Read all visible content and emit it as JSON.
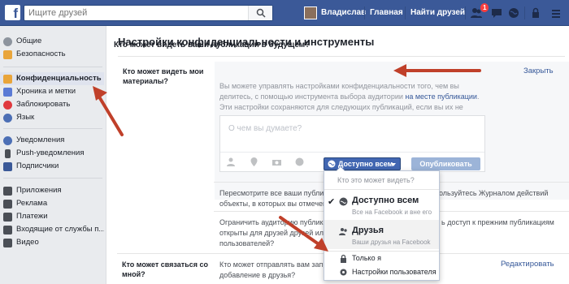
{
  "header": {
    "logo": "f",
    "search_placeholder": "Ищите друзей",
    "user_name": "Владислав",
    "home": "Главная",
    "find_friends": "Найти друзей",
    "friend_requests_count": "1",
    "icons": [
      "friend-requests-icon",
      "messages-icon",
      "notifications-icon",
      "lock-icon",
      "settings-icon"
    ]
  },
  "sidebar": {
    "items": [
      {
        "label": "Общие",
        "icon": "gear-icon",
        "color": "#8d949e"
      },
      {
        "label": "Безопасность",
        "icon": "security-badge-icon",
        "color": "#e9a53b"
      },
      {
        "label": "Конфиденциальность",
        "icon": "privacy-lock-icon",
        "color": "#e9a53b",
        "active": true
      },
      {
        "label": "Хроника и метки",
        "icon": "timeline-icon",
        "color": "#5b7bd5"
      },
      {
        "label": "Заблокировать",
        "icon": "block-icon",
        "color": "#e0393e"
      },
      {
        "label": "Язык",
        "icon": "language-icon",
        "color": "#4c6fb5"
      },
      {
        "label": "Уведомления",
        "icon": "globe-icon",
        "color": "#4c6fb5"
      },
      {
        "label": "Push-уведомления",
        "icon": "mobile-icon",
        "color": "#4b4f56"
      },
      {
        "label": "Подписчики",
        "icon": "rss-icon",
        "color": "#3b5998"
      },
      {
        "label": "Приложения",
        "icon": "apps-icon",
        "color": "#4b4f56"
      },
      {
        "label": "Реклама",
        "icon": "ads-icon",
        "color": "#4b4f56"
      },
      {
        "label": "Платежи",
        "icon": "payments-icon",
        "color": "#4b4f56"
      },
      {
        "label": "Входящие от службы п...",
        "icon": "support-inbox-icon",
        "color": "#4b4f56"
      },
      {
        "label": "Видео",
        "icon": "video-icon",
        "color": "#4b4f56"
      }
    ]
  },
  "main": {
    "title": "Настройки конфиденциальности и инструменты",
    "section1_label": "Кто может видеть мои материалы?",
    "expanded": {
      "question": "Кто может видеть ваши публикации в будущем?",
      "close": "Закрыть",
      "desc_a": "Вы можете управлять настройками конфиденциальности того, чем вы делитесь, с помощью инструмента выбора аудитории",
      "desc_link": "на месте публикации",
      "desc_b": ". Эти настройки сохраняются для следующих публикаций, если вы их не измените.",
      "composer_placeholder": "О чем вы думаете?",
      "audience_button": "Доступно всем",
      "publish_button": "Опубликовать"
    },
    "row2_a": "Пересмотрите все ваши публика",
    "row2_b": "объекты, в которых вы отмечен",
    "row2_right": "ользуйтесь Журналом действий",
    "row3_a": "Ограничить аудиторию публика",
    "row3_b": "открыты для друзей друзей или",
    "row3_c": "пользователей?",
    "row3_right": "ь доступ к прежним публикациям",
    "section2_label": "Кто может связаться со мной?",
    "row4_a": "Кто может отправлять вам запро",
    "row4_b": "добавление в друзья?",
    "edit_link": "Редактировать"
  },
  "dropdown": {
    "header": "Кто это может видеть?",
    "options": [
      {
        "title": "Доступно всем",
        "subtitle": "Все на Facebook и вне его",
        "checked": true,
        "icon": "globe-icon"
      },
      {
        "title": "Друзья",
        "subtitle": "Ваши друзья на Facebook",
        "icon": "friends-icon"
      },
      {
        "title": "Только я",
        "icon": "lock-icon"
      },
      {
        "title": "Настройки пользователя",
        "icon": "gear-icon"
      }
    ]
  }
}
